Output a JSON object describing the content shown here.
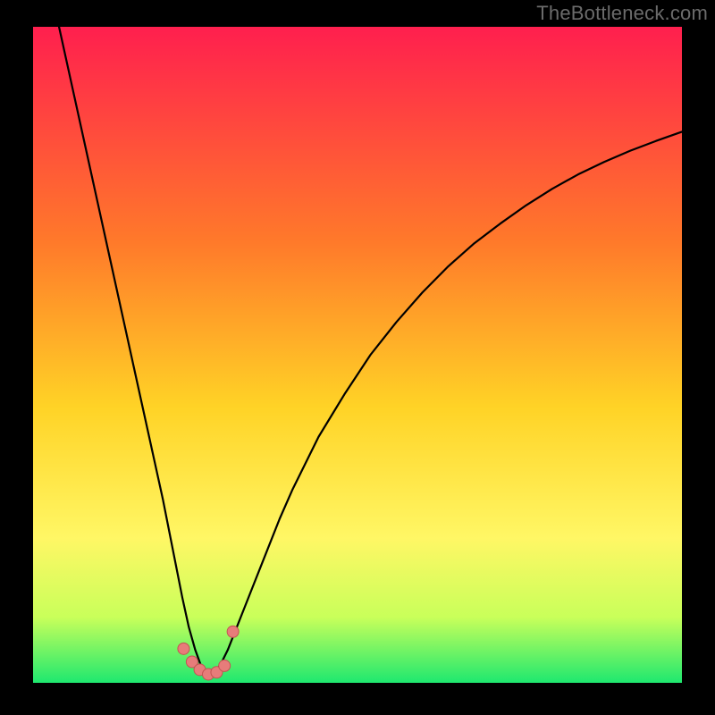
{
  "attribution": "TheBottleneck.com",
  "colors": {
    "gradient_top": "#ff1f4e",
    "gradient_upper_mid": "#ff7a2a",
    "gradient_mid": "#ffd326",
    "gradient_lower_mid": "#fff765",
    "gradient_lower": "#c9ff5a",
    "gradient_bottom": "#1ee86f",
    "curve": "#000000",
    "marker_fill": "#e77c7a",
    "marker_stroke": "#c35452",
    "frame": "#000000"
  },
  "chart_data": {
    "type": "line",
    "title": "",
    "xlabel": "",
    "ylabel": "",
    "xlim": [
      0,
      100
    ],
    "ylim": [
      0,
      100
    ],
    "optimum_x": 27,
    "series": [
      {
        "name": "bottleneck-curve",
        "x": [
          4,
          6,
          8,
          10,
          12,
          14,
          16,
          18,
          20,
          22,
          23,
          24,
          25,
          26,
          27,
          28,
          29,
          30,
          31,
          32,
          34,
          36,
          38,
          40,
          44,
          48,
          52,
          56,
          60,
          64,
          68,
          72,
          76,
          80,
          84,
          88,
          92,
          96,
          100
        ],
        "y": [
          100,
          91,
          82,
          73,
          64,
          55,
          46,
          37,
          28,
          18,
          13,
          8.5,
          5,
          2.3,
          1,
          1.5,
          3,
          5,
          7.5,
          10,
          15,
          20,
          25,
          29.5,
          37.5,
          44,
          50,
          55,
          59.5,
          63.5,
          67,
          70,
          72.8,
          75.3,
          77.5,
          79.4,
          81.1,
          82.6,
          84
        ]
      }
    ],
    "markers": {
      "name": "highlight-points",
      "x": [
        23.2,
        24.5,
        25.7,
        27.0,
        28.3,
        29.5,
        30.8
      ],
      "y": [
        5.2,
        3.2,
        2.0,
        1.3,
        1.6,
        2.6,
        7.8
      ]
    }
  }
}
